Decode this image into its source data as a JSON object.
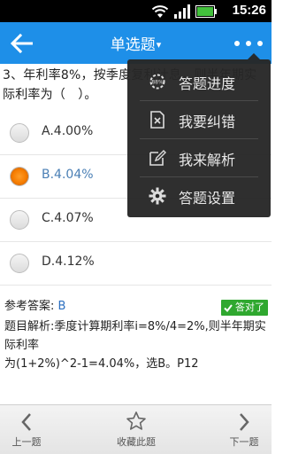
{
  "status_bar": {
    "time": "15:26",
    "icons": [
      "wifi-icon",
      "signal-icon",
      "battery-icon"
    ]
  },
  "app_bar": {
    "title": "单选题",
    "caret": "▾",
    "accent_color": "#1e8fe8"
  },
  "question": {
    "text": "3、年利率8%，按季度复利计息，则半年期实际利率为（　）。"
  },
  "options": [
    {
      "label": "A.4.00%",
      "selected": false
    },
    {
      "label": "B.4.04%",
      "selected": true
    },
    {
      "label": "C.4.07%",
      "selected": false
    },
    {
      "label": "D.4.12%",
      "selected": false
    }
  ],
  "answer": {
    "prefix": "参考答案: ",
    "value": "B",
    "badge": "答对了",
    "badge_color": "#2fa82f",
    "analysis_line1": "题目解析:季度计算期利率i=8%/4=2%,则半年期实际利率",
    "analysis_line2": "为(1+2%)^2-1=4.04%，选B。P12"
  },
  "menu": {
    "items": [
      {
        "label": "答题进度",
        "icon": "progress-icon"
      },
      {
        "label": "我要纠错",
        "icon": "report-error-icon"
      },
      {
        "label": "我来解析",
        "icon": "edit-icon"
      },
      {
        "label": "答题设置",
        "icon": "gear-icon"
      }
    ]
  },
  "bottom_nav": {
    "prev": "上一题",
    "favorite": "收藏此题",
    "next": "下一题"
  }
}
